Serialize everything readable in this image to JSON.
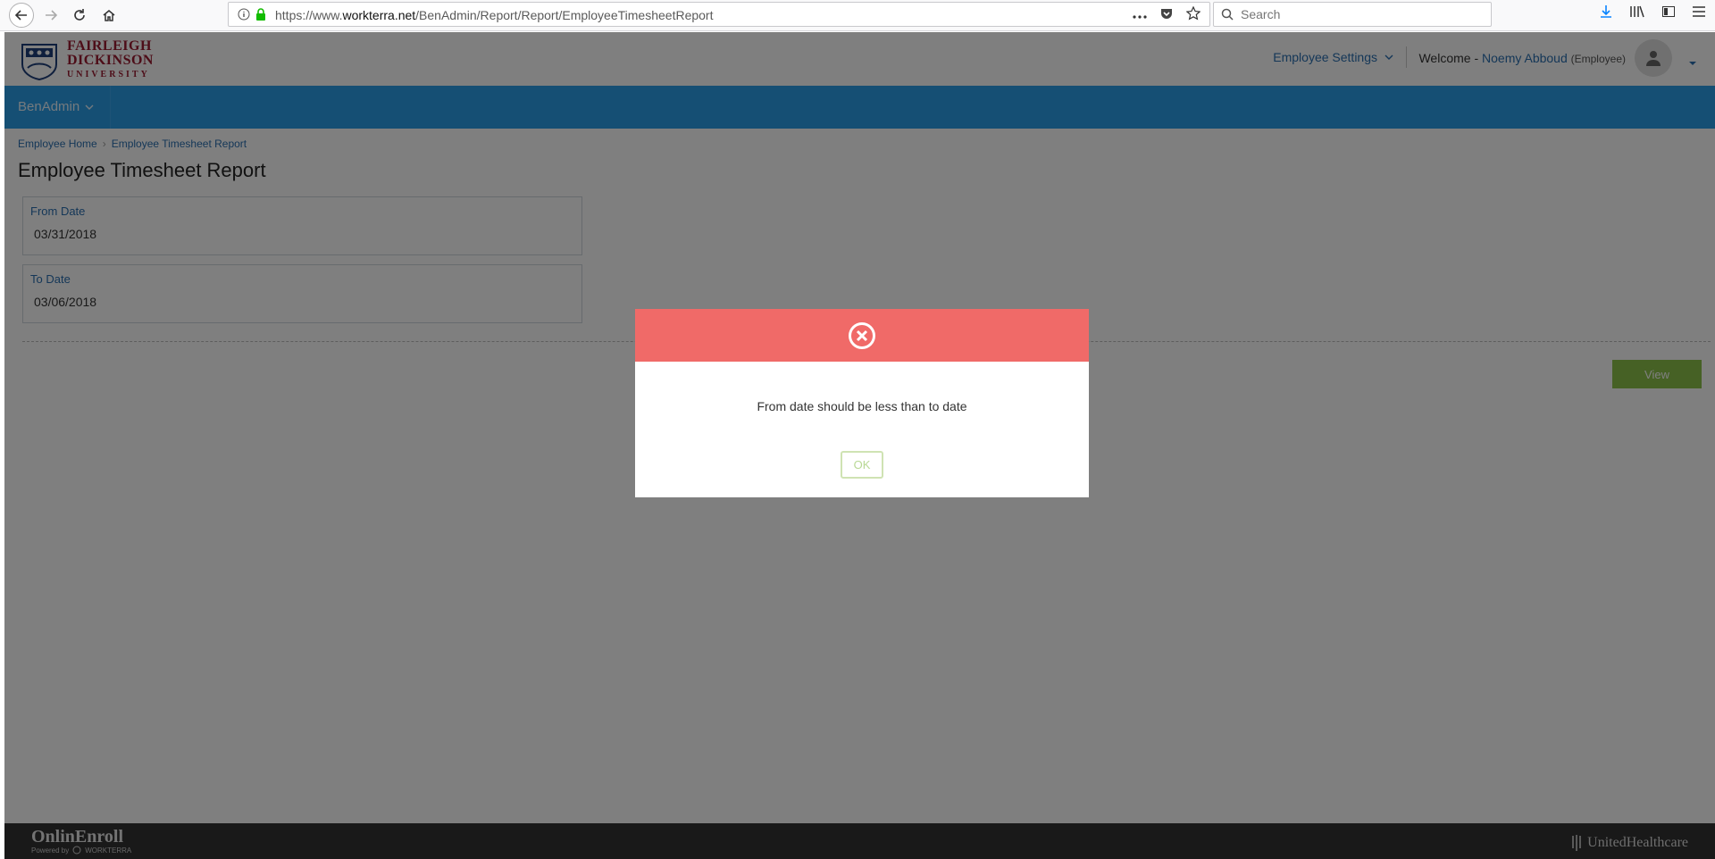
{
  "browser": {
    "url_prefix": "https://www.",
    "url_domain": "workterra.net",
    "url_path": "/BenAdmin/Report/Report/EmployeeTimesheetReport",
    "search_placeholder": "Search"
  },
  "header": {
    "logo_line1": "FAIRLEIGH",
    "logo_line2": "DICKINSON",
    "logo_line3": "UNIVERSITY",
    "employee_settings": "Employee Settings",
    "welcome_prefix": "Welcome - ",
    "user_name": "Noemy Abboud",
    "user_role": "(Employee)"
  },
  "navbar": {
    "menu_label": "BenAdmin"
  },
  "breadcrumb": {
    "home": "Employee Home",
    "current": "Employee Timesheet Report"
  },
  "page": {
    "title": "Employee Timesheet Report",
    "from_label": "From Date",
    "from_value": "03/31/2018",
    "to_label": "To Date",
    "to_value": "03/06/2018",
    "view_button": "View"
  },
  "modal": {
    "message": "From date should be less than to date",
    "ok_label": "OK"
  },
  "footer": {
    "brand": "OnlinEnroll",
    "powered_by": "Powered by",
    "powered_brand": "WORKTERRA",
    "partner": "UnitedHealthcare"
  },
  "colors": {
    "navbar": "#2b9ee8",
    "modal_header": "#f06a68",
    "view_button": "#8cc34a",
    "link": "#2a6fb0"
  }
}
